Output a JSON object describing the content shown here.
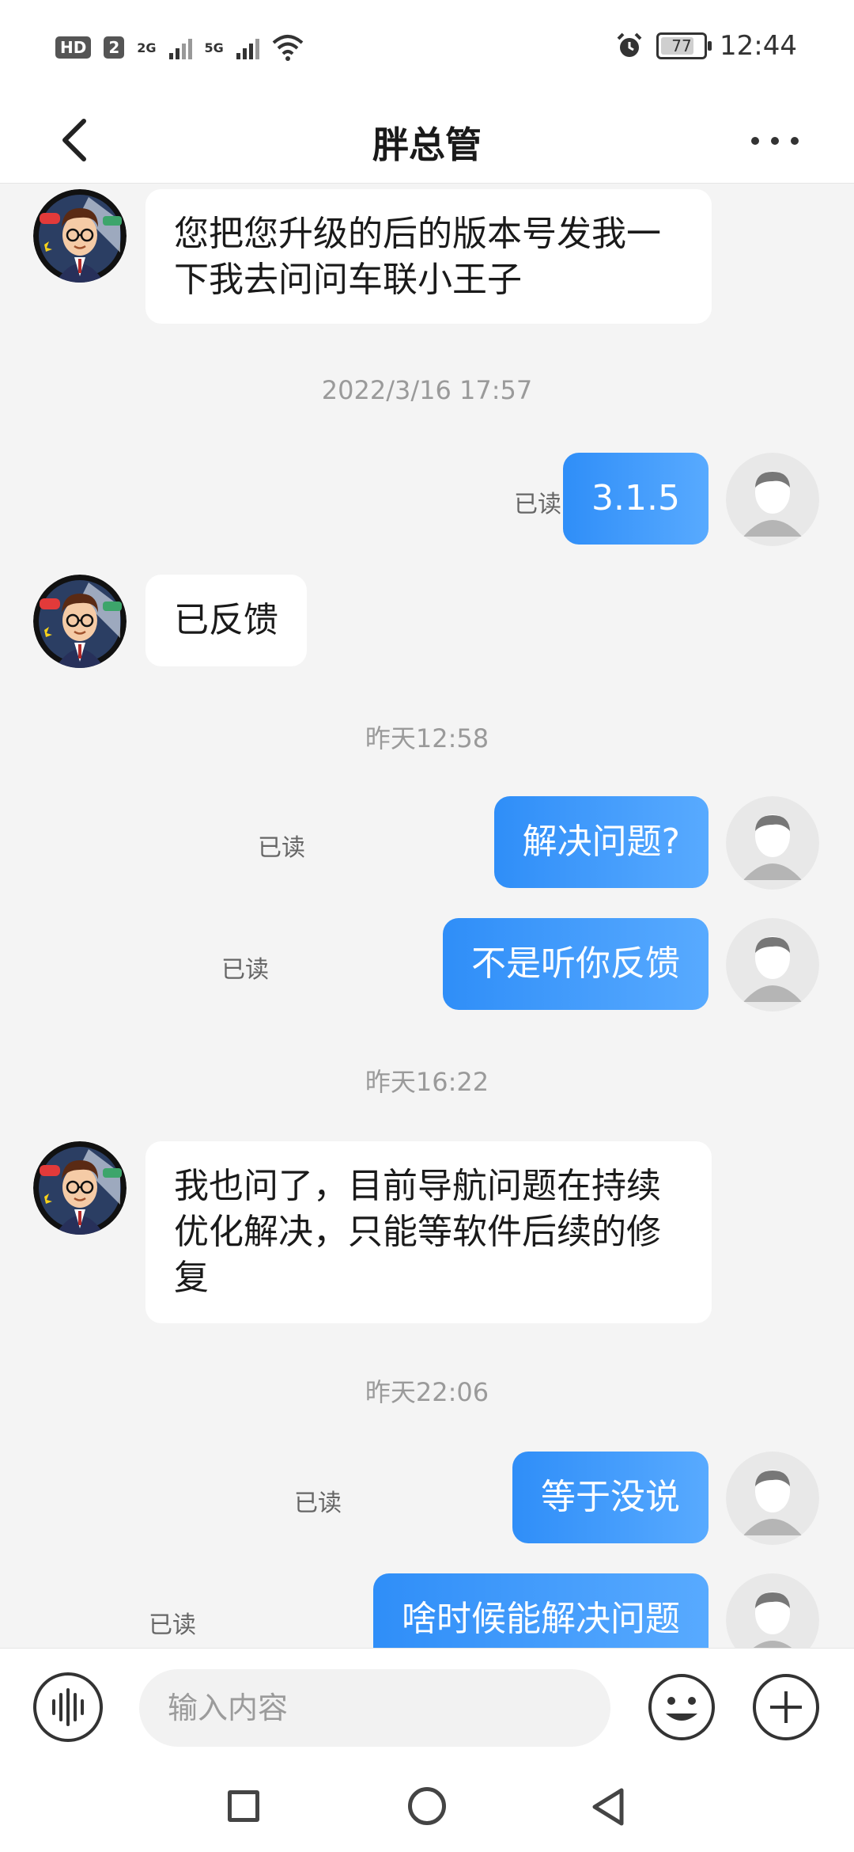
{
  "status_bar": {
    "left_badges": [
      "HD",
      "2",
      "2G",
      "5G"
    ],
    "battery": "77",
    "time": "12:44"
  },
  "header": {
    "title": "胖总管",
    "back_icon": "chevron-left-icon",
    "more_icon": "more-horizontal-icon"
  },
  "messages": [
    {
      "side": "in",
      "text": "您把您升级的后的版本号发我一下我去问问车联小王子"
    },
    {
      "type": "timestamp",
      "text": "2022/3/16 17:57"
    },
    {
      "side": "out",
      "text": "3.1.5",
      "status": "已读"
    },
    {
      "side": "in",
      "text": "已反馈"
    },
    {
      "type": "timestamp",
      "text": "昨天12:58"
    },
    {
      "side": "out",
      "text": "解决问题?",
      "status": "已读"
    },
    {
      "side": "out",
      "text": "不是听你反馈",
      "status": "已读"
    },
    {
      "type": "timestamp",
      "text": "昨天16:22"
    },
    {
      "side": "in",
      "text": "我也问了，目前导航问题在持续优化解决，只能等软件后续的修复"
    },
    {
      "type": "timestamp",
      "text": "昨天22:06"
    },
    {
      "side": "out",
      "text": "等于没说",
      "status": "已读"
    },
    {
      "side": "out",
      "text": "啥时候能解决问题",
      "status": "已读"
    }
  ],
  "input_bar": {
    "placeholder": "输入内容",
    "voice_icon": "voice-icon",
    "emoji_icon": "emoji-icon",
    "plus_icon": "plus-icon"
  },
  "nav_bar": {
    "icons": [
      "square-recents-icon",
      "circle-home-icon",
      "triangle-back-icon"
    ]
  },
  "colors": {
    "outgoing_bubble": "#3d9bfb",
    "incoming_bubble": "#ffffff",
    "chat_background": "#f4f4f4",
    "timestamp_text": "#9a9a9a"
  }
}
